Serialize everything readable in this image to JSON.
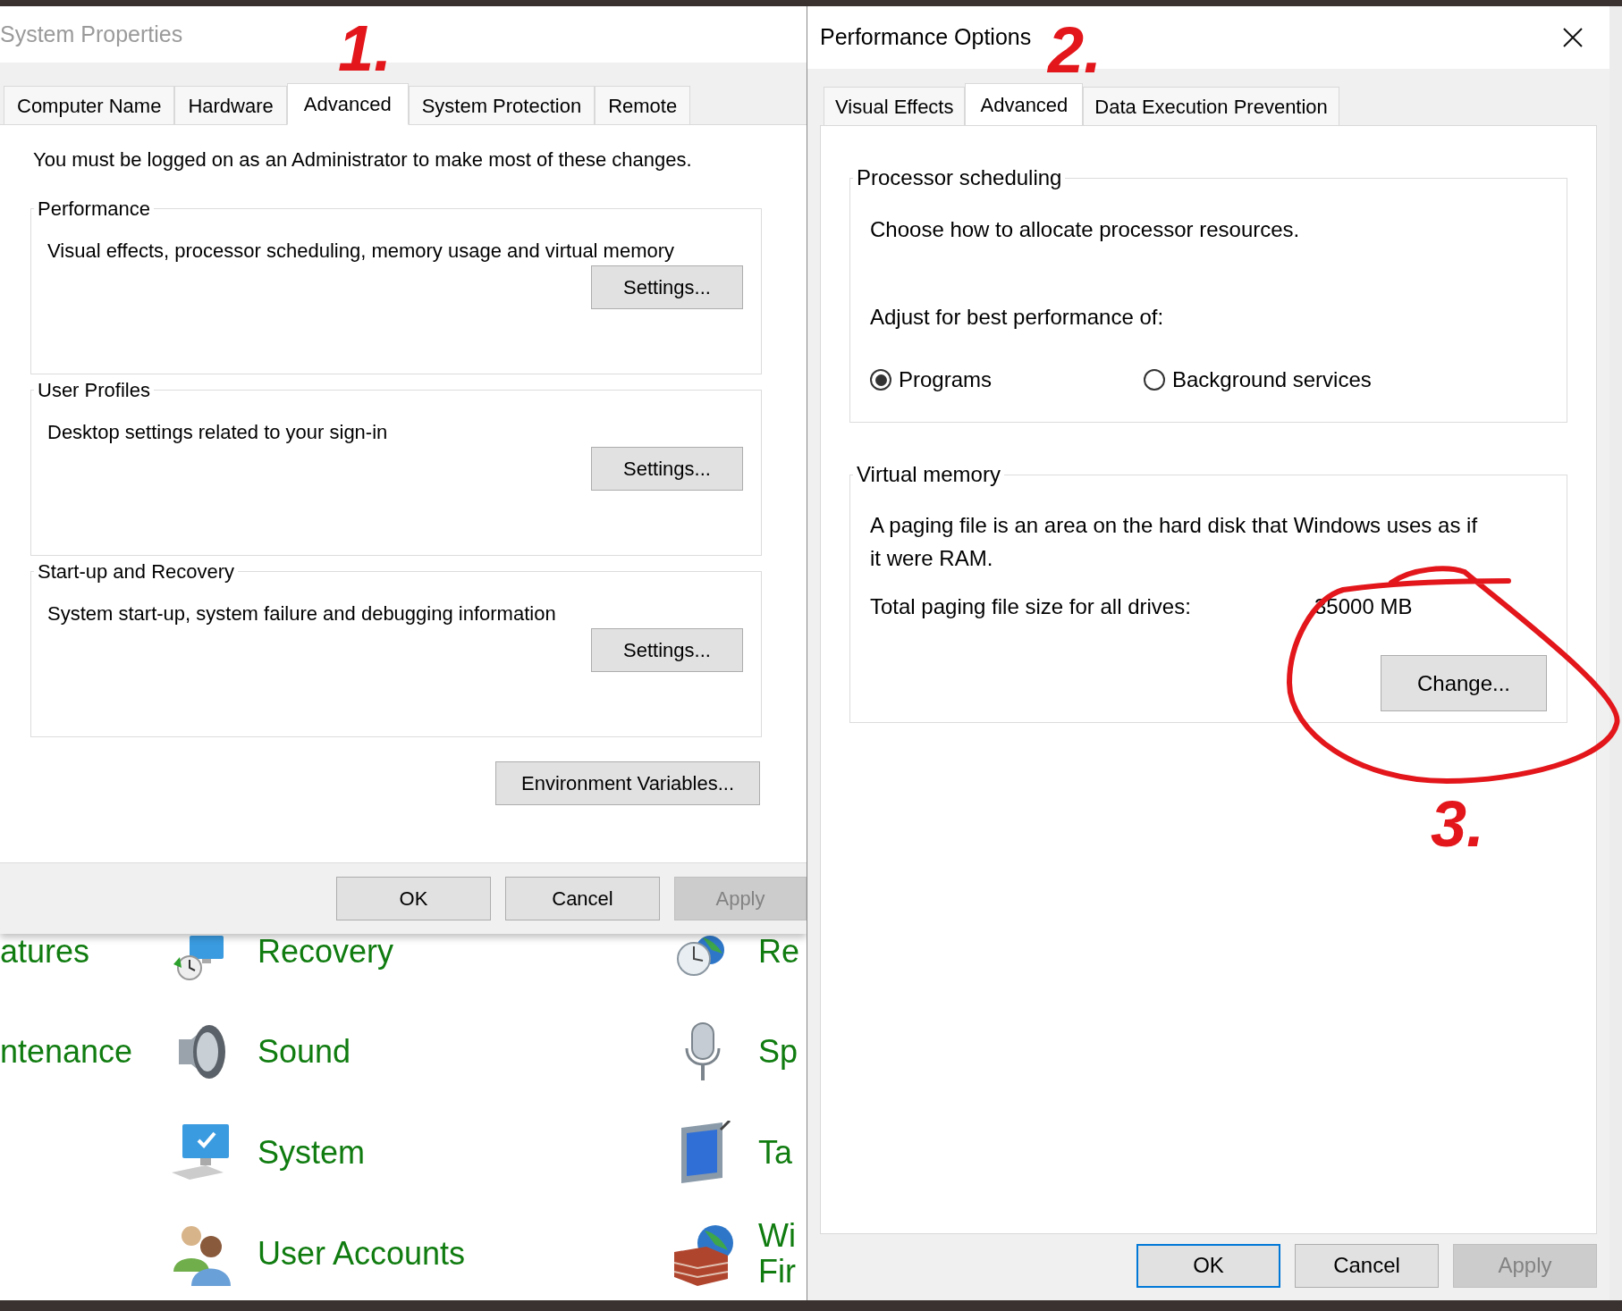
{
  "system_properties": {
    "title": "System Properties",
    "tabs": [
      {
        "label": "Computer Name",
        "selected": false
      },
      {
        "label": "Hardware",
        "selected": false
      },
      {
        "label": "Advanced",
        "selected": true
      },
      {
        "label": "System Protection",
        "selected": false
      },
      {
        "label": "Remote",
        "selected": false
      }
    ],
    "notice": "You must be logged on as an Administrator to make most of these changes.",
    "groups": [
      {
        "title": "Performance",
        "description": "Visual effects, processor scheduling, memory usage and virtual memory",
        "button": "Settings..."
      },
      {
        "title": "User Profiles",
        "description": "Desktop settings related to your sign-in",
        "button": "Settings..."
      },
      {
        "title": "Start-up and Recovery",
        "description": "System start-up, system failure and debugging information",
        "button": "Settings..."
      }
    ],
    "env_button": "Environment Variables...",
    "buttons": [
      {
        "label": "OK",
        "disabled": false
      },
      {
        "label": "Cancel",
        "disabled": false
      },
      {
        "label": "Apply",
        "disabled": true
      }
    ]
  },
  "performance_options": {
    "title": "Performance Options",
    "tabs": [
      {
        "label": "Visual Effects",
        "selected": false
      },
      {
        "label": "Advanced",
        "selected": true
      },
      {
        "label": "Data Execution Prevention",
        "selected": false
      }
    ],
    "processor_scheduling": {
      "title": "Processor scheduling",
      "description": "Choose how to allocate processor resources.",
      "prompt": "Adjust for best performance of:",
      "options": [
        {
          "label": "Programs",
          "selected": true
        },
        {
          "label": "Background services",
          "selected": false
        }
      ]
    },
    "virtual_memory": {
      "title": "Virtual memory",
      "description": "A paging file is an area on the hard disk that Windows uses as if it were RAM.",
      "total_label": "Total paging file size for all drives:",
      "total_value": "35000 MB",
      "button": "Change..."
    },
    "buttons": [
      {
        "label": "OK",
        "default": true,
        "disabled": false
      },
      {
        "label": "Cancel",
        "default": false,
        "disabled": false
      },
      {
        "label": "Apply",
        "default": false,
        "disabled": true
      }
    ]
  },
  "control_panel": {
    "columns": [
      [
        {
          "kind": "none",
          "lines": [
            "atures"
          ]
        },
        {
          "kind": "none",
          "lines": [
            "ntenance"
          ]
        }
      ],
      [
        {
          "kind": "recovery",
          "lines": [
            "Recovery"
          ]
        },
        {
          "kind": "sound",
          "lines": [
            "Sound"
          ]
        },
        {
          "kind": "system",
          "lines": [
            "System"
          ]
        },
        {
          "kind": "users",
          "lines": [
            "User Accounts"
          ]
        }
      ],
      [
        {
          "kind": "clock",
          "lines": [
            "Re"
          ]
        },
        {
          "kind": "microphone",
          "lines": [
            "Sp"
          ]
        },
        {
          "kind": "tablet",
          "lines": [
            "Ta"
          ]
        },
        {
          "kind": "firewall",
          "lines": [
            "Wi",
            "Fir"
          ]
        }
      ]
    ]
  },
  "annotations": [
    {
      "text": "1."
    },
    {
      "text": "2."
    },
    {
      "text": "3."
    }
  ]
}
